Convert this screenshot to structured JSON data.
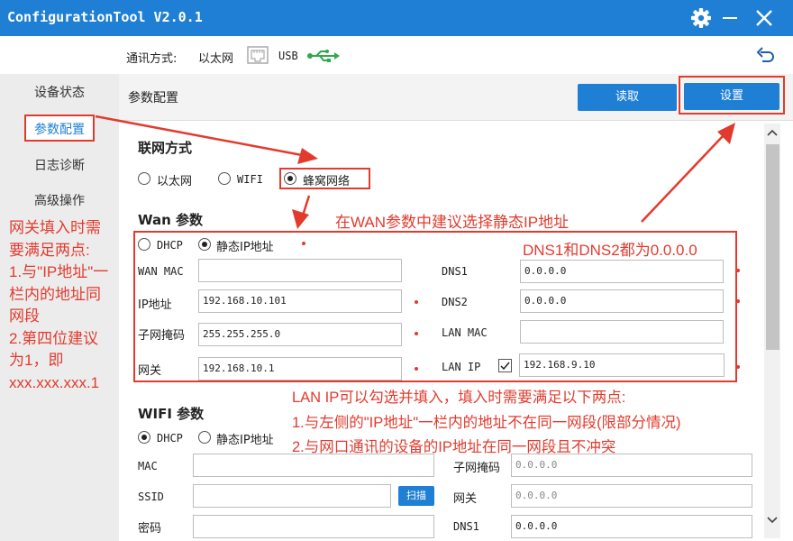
{
  "window": {
    "title": "ConfigurationTool V2.0.1"
  },
  "comm": {
    "label": "通讯方式:",
    "ethernet": "以太网",
    "usb": "USB"
  },
  "sidebar": {
    "items": [
      "设备状态",
      "参数配置",
      "日志诊断",
      "高级操作"
    ]
  },
  "main": {
    "title": "参数配置",
    "read_label": "读取",
    "set_label": "设置"
  },
  "net_mode": {
    "title": "联网方式",
    "options": [
      "以太网",
      "WIFI",
      "蜂窝网络"
    ],
    "selected": "蜂窝网络"
  },
  "wan": {
    "title": "Wan 参数",
    "mode_options": [
      "DHCP",
      "静态IP地址"
    ],
    "selected_mode": "静态IP地址",
    "wan_mac_label": "WAN MAC",
    "wan_mac_value": "",
    "ip_label": "IP地址",
    "ip_value": "192.168.10.101",
    "mask_label": "子网掩码",
    "mask_value": "255.255.255.0",
    "gateway_label": "网关",
    "gateway_value": "192.168.10.1",
    "dns1_label": "DNS1",
    "dns1_value": "0.0.0.0",
    "dns2_label": "DNS2",
    "dns2_value": "0.0.0.0",
    "lan_mac_label": "LAN MAC",
    "lan_mac_value": "",
    "lan_ip_label": "LAN IP",
    "lan_ip_checked": true,
    "lan_ip_value": "192.168.9.10"
  },
  "wifi": {
    "title": "WIFI 参数",
    "mode_options": [
      "DHCP",
      "静态IP地址"
    ],
    "selected_mode": "DHCP",
    "mac_label": "MAC",
    "mac_value": "",
    "ssid_label": "SSID",
    "ssid_value": "",
    "scan_label": "扫描",
    "password_label": "密码",
    "password_value": "",
    "mask_label": "子网掩码",
    "mask_value": "0.0.0.0",
    "gateway_label": "网关",
    "gateway_value": "0.0.0.0",
    "dns1_label": "DNS1",
    "dns1_value": "0.0.0.0"
  },
  "annotations": {
    "wan_tip": "在WAN参数中建议选择静态IP地址",
    "dns_tip": "DNS1和DNS2都为0.0.0.0",
    "gateway_tip": [
      "网关填入时需",
      "要满足两点:",
      "1.与\"IP地址\"一",
      "栏内的地址同",
      "网段",
      "2.第四位建议",
      "为1，即",
      "xxx.xxx.xxx.1"
    ],
    "lan_tip": [
      "LAN IP可以勾选并填入，填入时需要满足以下两点:",
      "1.与左侧的\"IP地址\"一栏内的地址不在同一网段(限部分情况)",
      "2.与网口通讯的设备的IP地址在同一网段且不冲突"
    ]
  },
  "colors": {
    "titlebar": "#1f7fd4",
    "annotation": "#e23b2e",
    "sidebar": "#ececec"
  }
}
